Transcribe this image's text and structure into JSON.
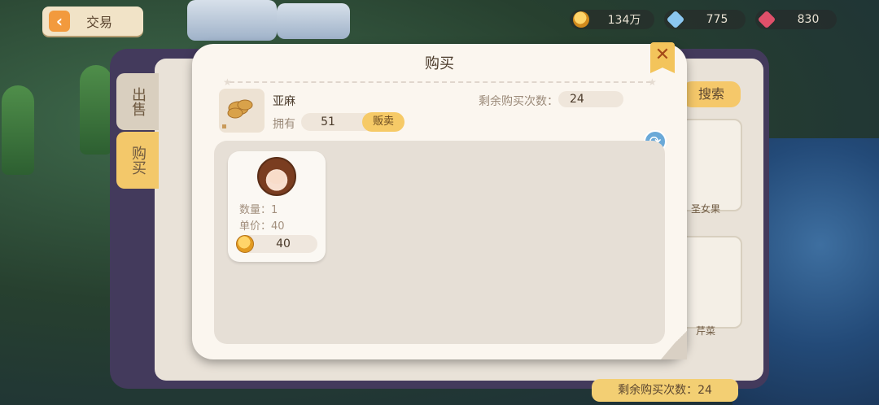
{
  "topbar": {
    "back_label": "交易",
    "gold": "134万",
    "gems": "775",
    "rubies": "830"
  },
  "trade_window": {
    "tabs": [
      "出售",
      "购买"
    ],
    "search_label": "搜索",
    "items": [
      "圣女果",
      "芹菜"
    ],
    "remaining_bottom": "剩余购买次数：24"
  },
  "modal": {
    "title": "购买",
    "close_label": "✕",
    "item_name": "亚麻",
    "own_label": "拥有",
    "own_value": "51",
    "sell_label": "贩卖",
    "remaining_label": "剩余购买次数：",
    "remaining_value": "24",
    "listings": [
      {
        "quantity_label": "数量：1",
        "unit_price_label": "单价：40",
        "total": "40"
      }
    ]
  },
  "icons": {
    "back": "back-arrow-icon",
    "gold": "gold-coin-icon",
    "gem": "diamond-icon",
    "ruby": "ruby-icon",
    "refresh": "refresh-icon",
    "close": "close-icon"
  },
  "colors": {
    "accent": "#f3c45b",
    "modal_bg": "#fbf6ef",
    "list_bg": "#e6dfd6",
    "panel": "#433a5c"
  }
}
